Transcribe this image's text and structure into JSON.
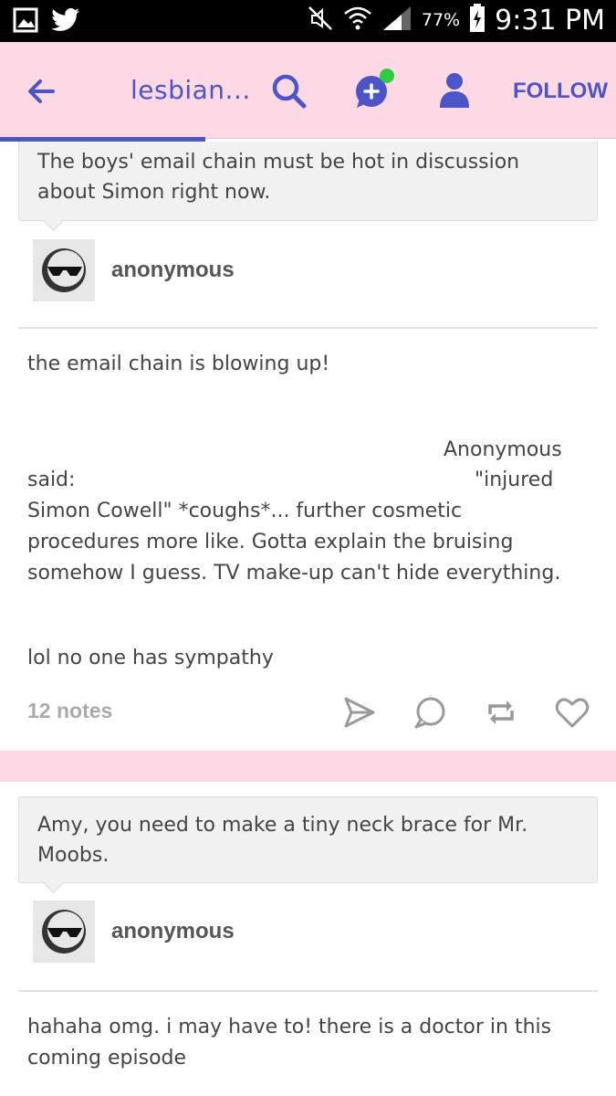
{
  "status_bar": {
    "battery": "77%",
    "time": "9:31 PM"
  },
  "header": {
    "blog_name": "lesbian...",
    "follow_label": "FOLLOW"
  },
  "posts": [
    {
      "question": "The boys' email chain must be hot in discussion about Simon right now.",
      "asker": "anonymous",
      "answer": {
        "line1": "the email chain is blowing up!",
        "quote_author": "Anonymous",
        "said": "said:",
        "quote_start": "\"injured",
        "quote_l1": "Simon Cowell\" *coughs*...  further cosmetic",
        "quote_l2": "procedures more like. Gotta explain the bruising",
        "quote_l3": "somehow I guess. TV make-up can't hide everything.",
        "line_last": "lol no one has sympathy"
      },
      "notes": "12 notes"
    },
    {
      "question": "Amy, you need to make a tiny neck brace for Mr. Moobs.",
      "asker": "anonymous",
      "answer": {
        "line1": "hahaha omg. i may have to! there is a doctor in this",
        "line2": "coming episode"
      }
    }
  ],
  "colors": {
    "header_bg": "#fdd9e5",
    "accent": "#4b55c8",
    "notification_dot": "#2ecc40"
  },
  "icons": [
    "gallery-icon",
    "twitter-icon",
    "mute-icon",
    "wifi-icon",
    "signal-icon",
    "battery-icon",
    "back-arrow-icon",
    "search-icon",
    "new-message-icon",
    "person-icon",
    "avatar-sunglasses-icon",
    "share-icon",
    "reply-icon",
    "reblog-icon",
    "like-icon"
  ]
}
